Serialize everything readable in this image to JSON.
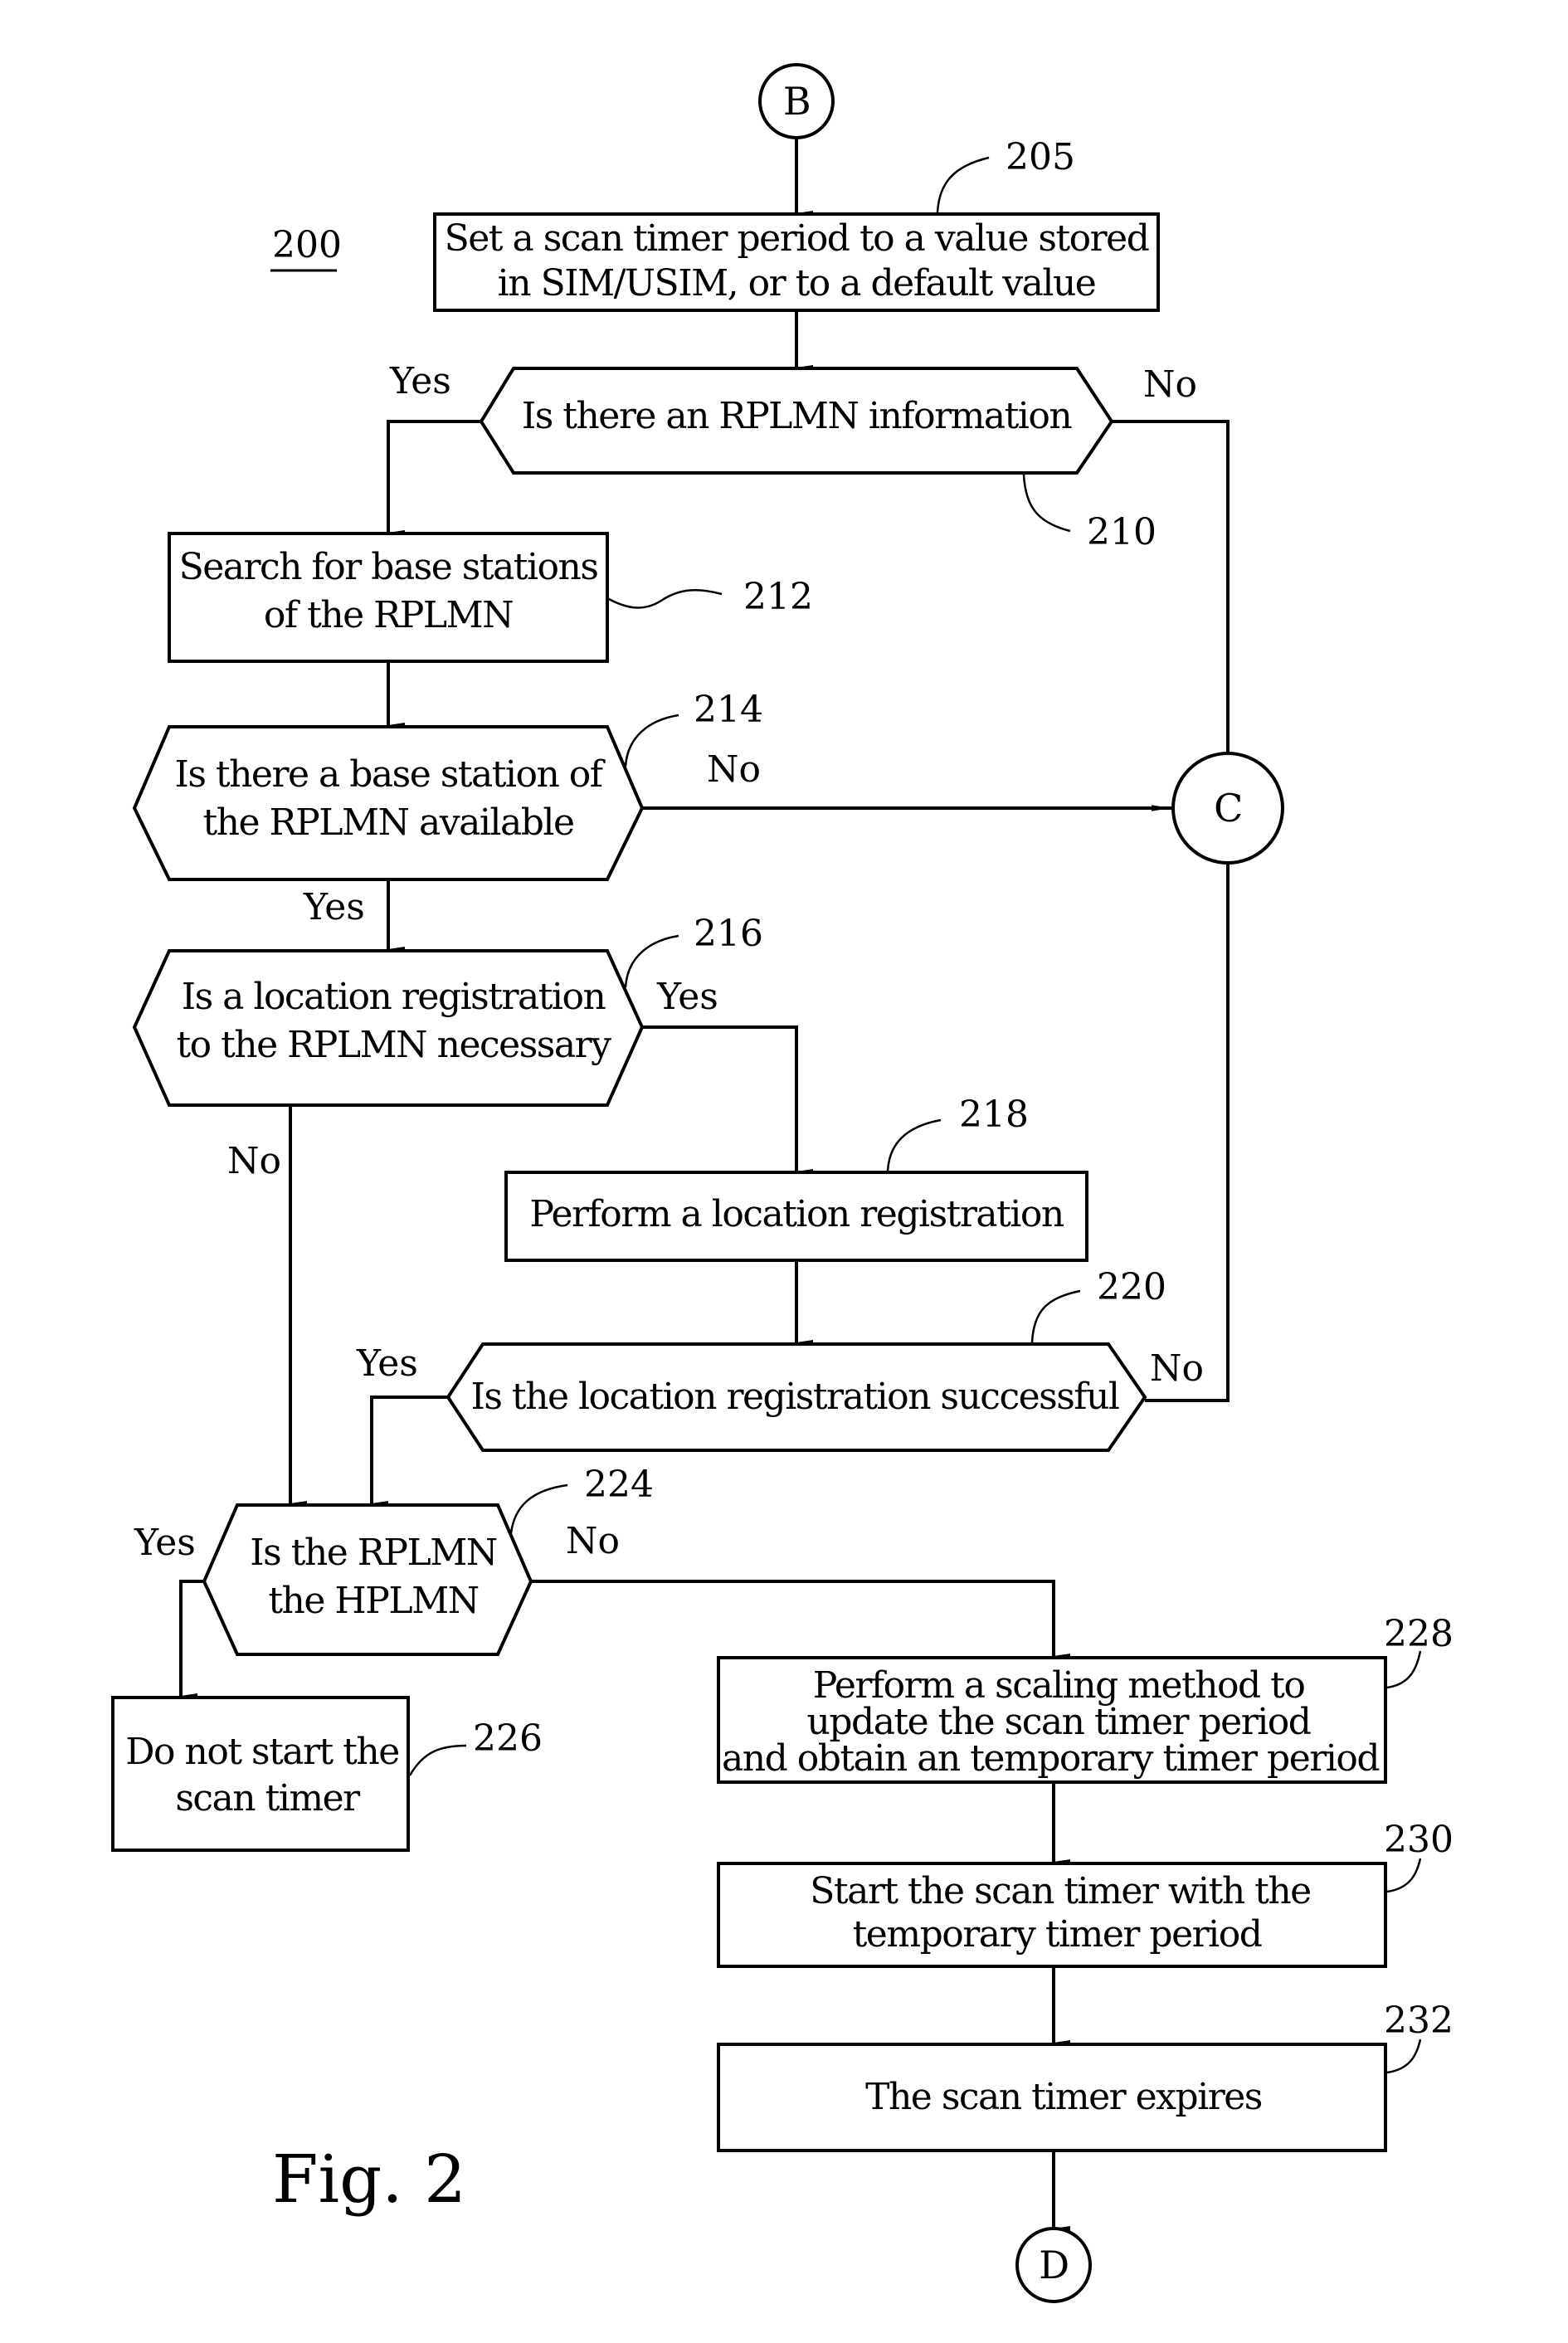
{
  "figure": {
    "caption": "Fig. 2",
    "reference": "200"
  },
  "connectors": {
    "start": "B",
    "mid": "C",
    "end": "D"
  },
  "steps": {
    "s205": {
      "ref": "205",
      "lines": [
        "Set a scan timer period to a value stored",
        "in SIM/USIM, or to a default value"
      ]
    },
    "s210": {
      "ref": "210",
      "lines": [
        "Is there an RPLMN information"
      ]
    },
    "s212": {
      "ref": "212",
      "lines": [
        "Search for base stations",
        "of the RPLMN"
      ]
    },
    "s214": {
      "ref": "214",
      "lines": [
        "Is there a base station of",
        "the RPLMN available"
      ]
    },
    "s216": {
      "ref": "216",
      "lines": [
        "Is a location registration",
        "to the RPLMN necessary"
      ]
    },
    "s218": {
      "ref": "218",
      "lines": [
        "Perform a location registration"
      ]
    },
    "s220": {
      "ref": "220",
      "lines": [
        "Is the location registration successful"
      ]
    },
    "s224": {
      "ref": "224",
      "lines": [
        "Is the RPLMN",
        "the HPLMN"
      ]
    },
    "s226": {
      "ref": "226",
      "lines": [
        "Do not start the",
        "scan timer"
      ]
    },
    "s228": {
      "ref": "228",
      "lines": [
        "Perform a scaling method to",
        "update the scan timer period",
        "and obtain an temporary timer period"
      ]
    },
    "s230": {
      "ref": "230",
      "lines": [
        "Start the scan timer with the",
        "temporary timer period"
      ]
    },
    "s232": {
      "ref": "232",
      "lines": [
        "The scan timer expires"
      ]
    }
  },
  "branch_labels": {
    "d210_yes": "Yes",
    "d210_no": "No",
    "d214_yes": "Yes",
    "d214_no": "No",
    "d216_yes": "Yes",
    "d216_no": "No",
    "d220_yes": "Yes",
    "d220_no": "No",
    "d224_yes": "Yes",
    "d224_no": "No"
  }
}
